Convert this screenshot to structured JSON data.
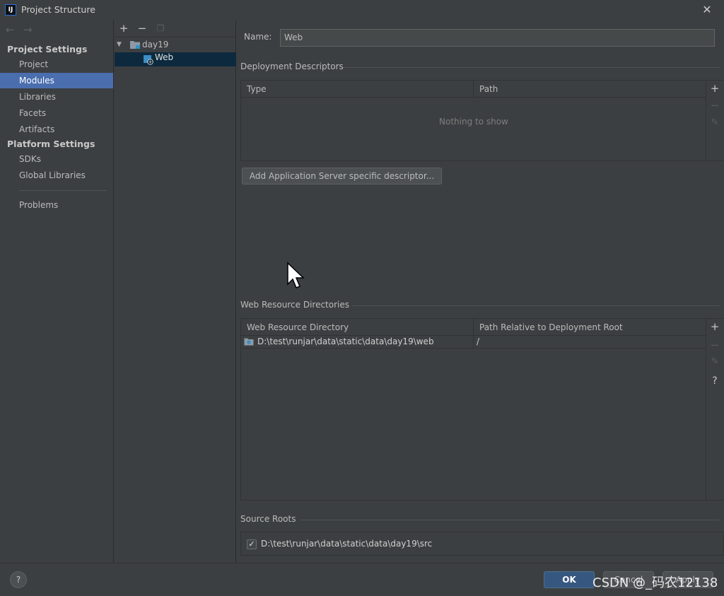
{
  "window": {
    "title": "Project Structure",
    "app_icon_text": "IJ"
  },
  "nav": {
    "project_settings_header": "Project Settings",
    "platform_settings_header": "Platform Settings",
    "items": [
      "Project",
      "Modules",
      "Libraries",
      "Facets",
      "Artifacts"
    ],
    "platform_items": [
      "SDKs",
      "Global Libraries"
    ],
    "problems": "Problems",
    "selected": "Modules"
  },
  "tree": {
    "root": "day19",
    "child": "Web"
  },
  "main": {
    "name_label": "Name:",
    "name_value": "Web",
    "deployment_title": "Deployment Descriptors",
    "deployment_columns": [
      "Type",
      "Path"
    ],
    "deployment_empty": "Nothing to show",
    "add_descriptor_button": "Add Application Server specific descriptor...",
    "web_resource_title": "Web Resource Directories",
    "web_resource_columns": [
      "Web Resource Directory",
      "Path Relative to Deployment Root"
    ],
    "web_resource_rows": [
      {
        "directory": "D:\\test\\runjar\\data\\static\\data\\day19\\web",
        "relative_path": "/"
      }
    ],
    "source_roots_title": "Source Roots",
    "source_root": {
      "checked": true,
      "path": "D:\\test\\runjar\\data\\static\\data\\day19\\src"
    }
  },
  "footer": {
    "help": "?",
    "ok": "OK",
    "cancel": "Cancel",
    "apply": "Apply",
    "watermark": "CSDN @_码农12138"
  },
  "colors": {
    "background": "#3c3f41",
    "selection": "#4b6eaf",
    "tree_selection": "#0d293e",
    "ok_button": "#365880"
  }
}
